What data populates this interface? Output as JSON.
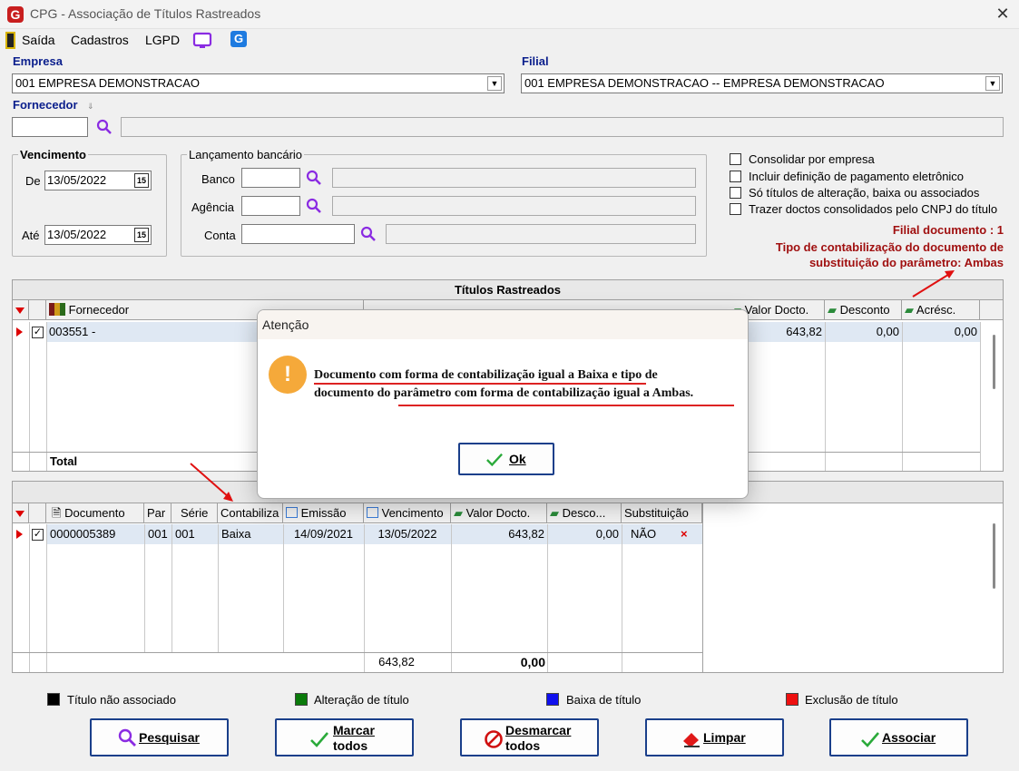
{
  "window": {
    "title": "CPG - Associação de Títulos Rastreados",
    "logo": "G",
    "close": "✕"
  },
  "menu": {
    "exit": "Saída",
    "registers": "Cadastros",
    "lgpd": "LGPD"
  },
  "company": {
    "label": "Empresa",
    "value": "001 EMPRESA DEMONSTRACAO"
  },
  "branch": {
    "label": "Filial",
    "value": "001 EMPRESA DEMONSTRACAO -- EMPRESA DEMONSTRACAO"
  },
  "supplier": {
    "label": "Fornecedor"
  },
  "due": {
    "legend": "Vencimento",
    "from_label": "De",
    "from": "13/05/2022",
    "to_label": "Até",
    "to": "13/05/2022"
  },
  "bank": {
    "legend": "Lançamento bancário",
    "bank_label": "Banco",
    "agency_label": "Agência",
    "account_label": "Conta"
  },
  "options": [
    {
      "label": "Consolidar por empresa",
      "checked": false
    },
    {
      "label": "Incluir definição de pagamento eletrônico",
      "checked": false
    },
    {
      "label": "Só títulos de alteração, baixa ou associados",
      "checked": false
    },
    {
      "label": "Trazer doctos consolidados pelo CNPJ do título",
      "checked": false
    }
  ],
  "info": {
    "branch_doc": "Filial documento : 1",
    "accounting_type_1": "Tipo de contabilização do documento de",
    "accounting_type_2": "substituição do parâmetro: Ambas"
  },
  "tracked": {
    "title": "Títulos Rastreados",
    "columns": {
      "supplier": "Fornecedor",
      "doc_value": "Valor Docto.",
      "discount": "Desconto",
      "addition": "Acrésc."
    },
    "row": {
      "supplier": "003551 -",
      "doc_value": "643,82",
      "discount": "0,00",
      "addition": "0,00"
    },
    "total_label": "Total"
  },
  "docs": {
    "columns": {
      "document": "Documento",
      "par": "Par",
      "series": "Série",
      "accounting": "Contabiliza",
      "issue": "Emissão",
      "due": "Vencimento",
      "doc_value": "Valor Docto.",
      "discount": "Desco...",
      "substitution": "Substituição"
    },
    "row": {
      "document": "0000005389",
      "par": "001",
      "series": "001",
      "accounting": "Baixa",
      "issue": "14/09/2021",
      "due": "13/05/2022",
      "doc_value": "643,82",
      "discount": "0,00",
      "substitution": "NÃO",
      "remove": "×"
    },
    "totals": {
      "doc_value": "643,82",
      "discount": "0,00"
    }
  },
  "legend": [
    {
      "label": "Título não associado",
      "color": "#000000"
    },
    {
      "label": "Alteração de título",
      "color": "#0a7a0a"
    },
    {
      "label": "Baixa de título",
      "color": "#1010ee"
    },
    {
      "label": "Exclusão de título",
      "color": "#ee1010"
    }
  ],
  "buttons": {
    "search": "Pesquisar",
    "mark_1": "Marcar",
    "mark_2": "todos",
    "unmark_1": "Desmarcar",
    "unmark_2": "todos",
    "clear": "Limpar",
    "associate": "Associar"
  },
  "dialog": {
    "title": "Atenção",
    "icon": "!",
    "line1_a": "Documento com forma de contabilização igual a Baixa",
    "line1_b": " e tipo de",
    "line2": "documento do parâmetro com forma de contabilização igual a Ambas.",
    "ok": "Ok"
  }
}
